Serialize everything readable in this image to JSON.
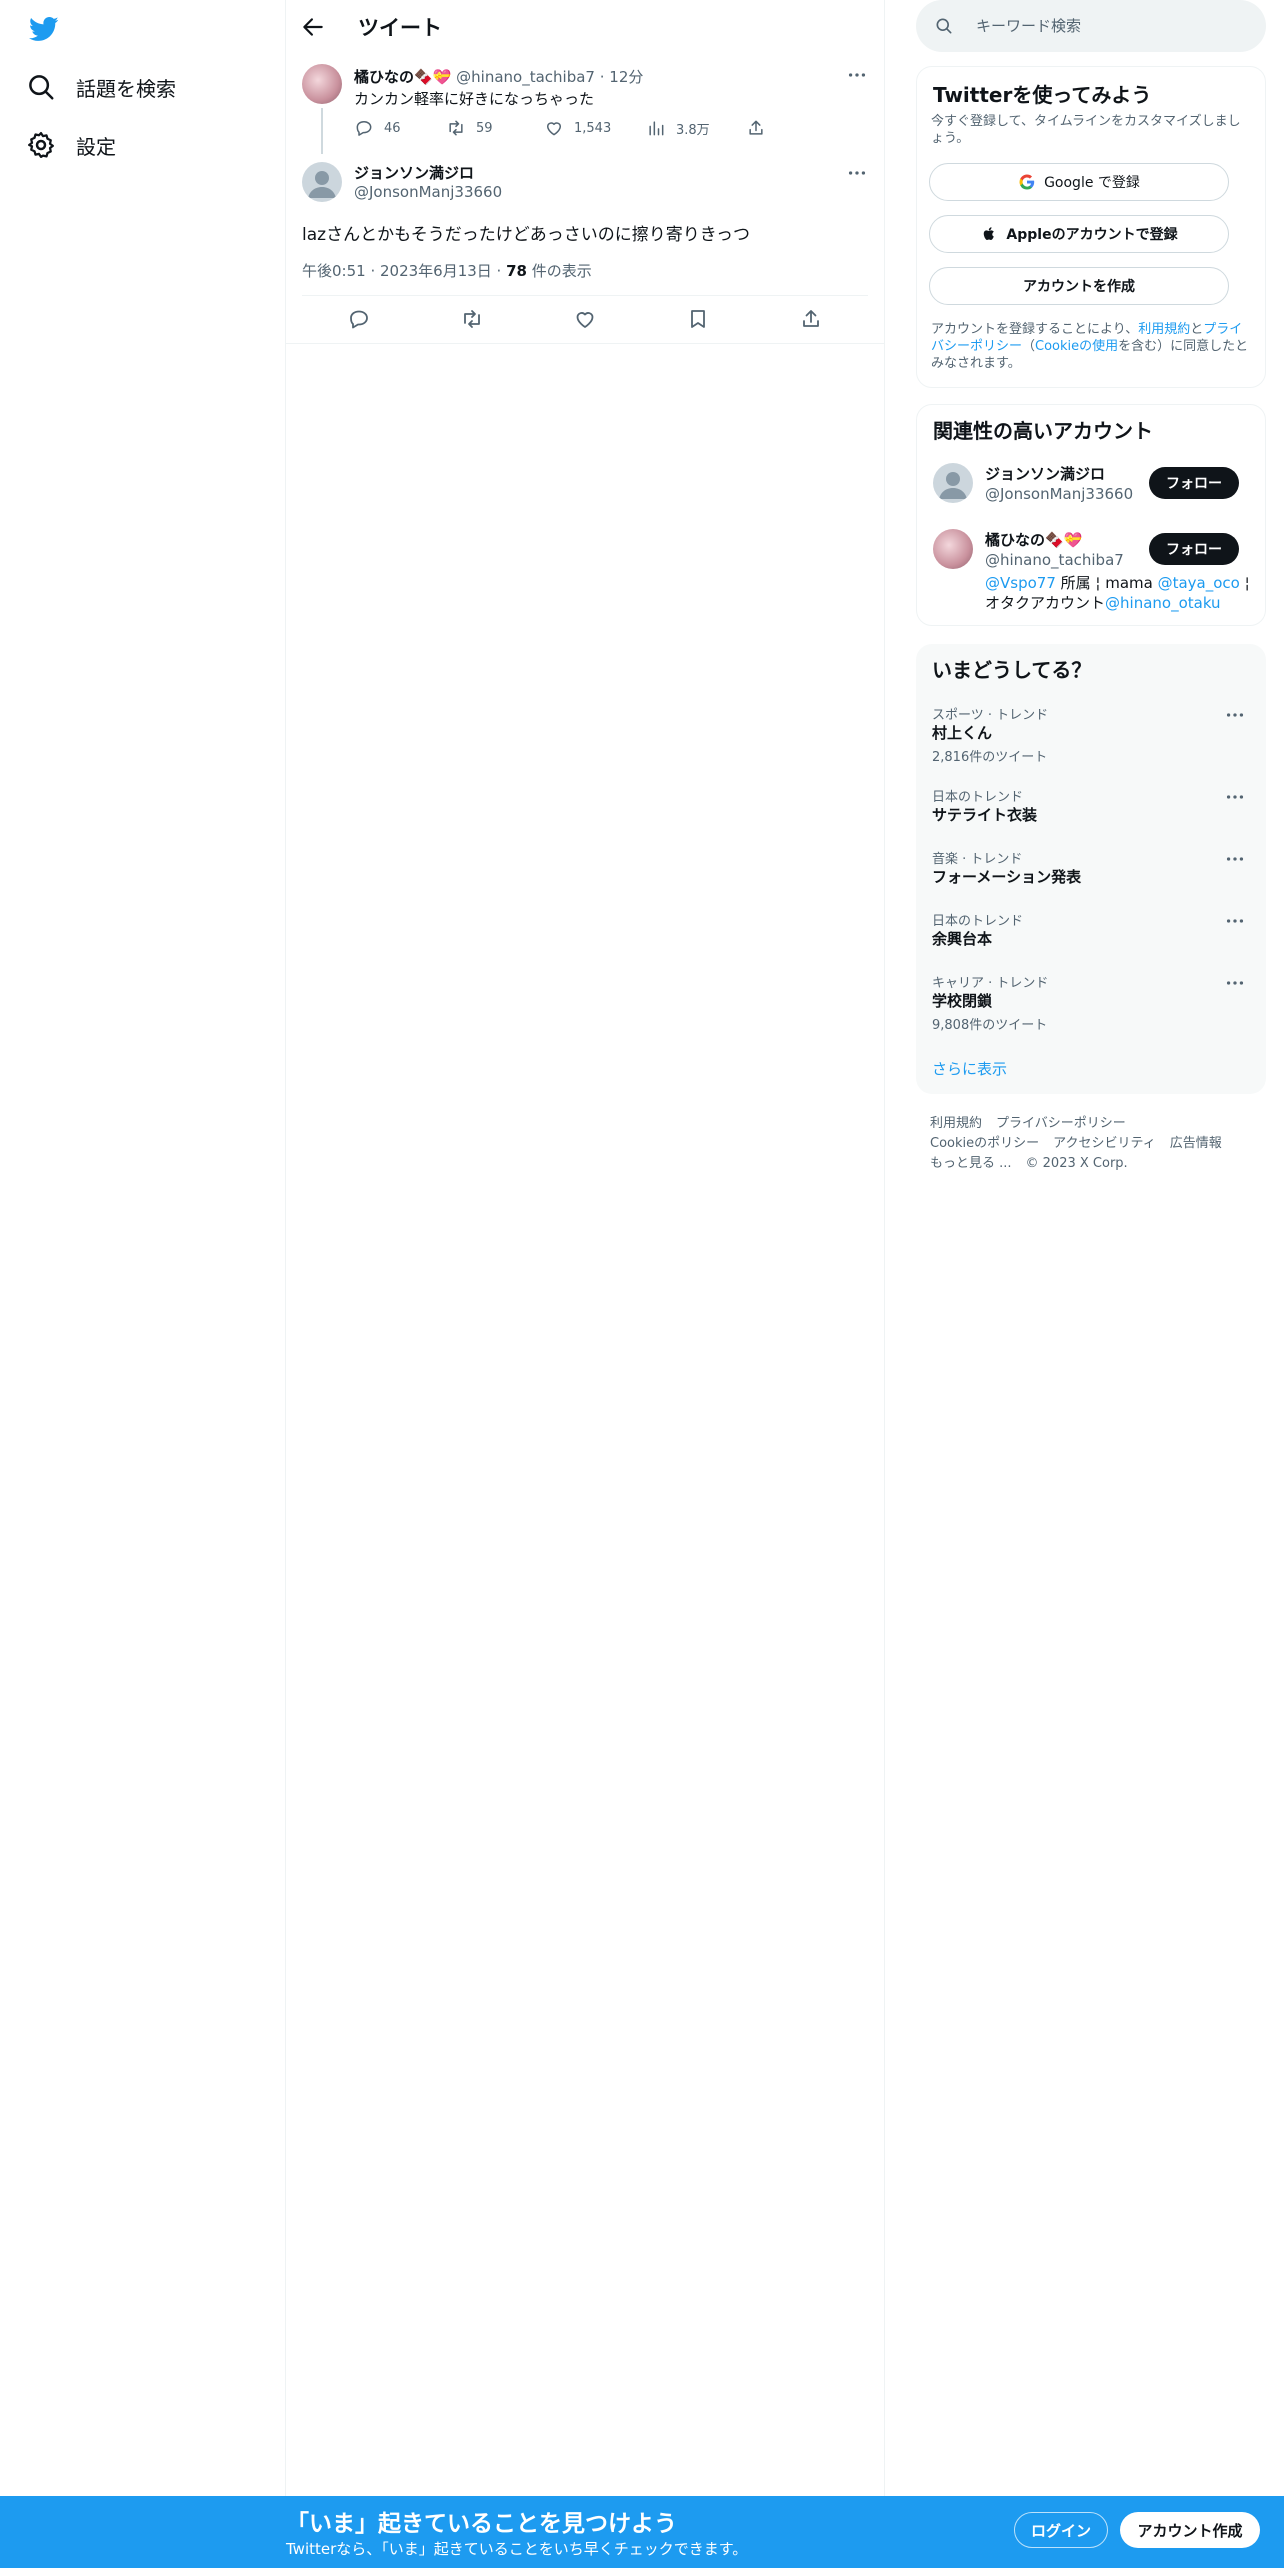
{
  "nav": {
    "logo": "twitter-bird-icon",
    "items": [
      {
        "label": "話題を検索",
        "icon": "search-icon"
      },
      {
        "label": "設定",
        "icon": "gear-icon"
      }
    ]
  },
  "main": {
    "title": "ツイート",
    "parent_tweet": {
      "name": "橘ひなの🍫💝",
      "handle": "@hinano_tachiba7",
      "dot": "·",
      "time": "12分",
      "text": "カンカン軽率に好きになっちゃった",
      "replies": "46",
      "retweets": "59",
      "likes": "1,543",
      "views": "3.8万"
    },
    "tweet": {
      "name": "ジョンソン満ジロ",
      "handle": "@JonsonManj33660",
      "text": "lazさんとかもそうだったけどあっさいのに擦り寄りきっつ",
      "datetime": "午後0:51 · 2023年6月13日 · ",
      "views": "78",
      "views_label": " 件の表示"
    }
  },
  "right": {
    "search_placeholder": "キーワード検索",
    "signup": {
      "title": "Twitterを使ってみよう",
      "subtitle": "今すぐ登録して、タイムラインをカスタマイズしましょう。",
      "google": "Google で登録",
      "apple": "Appleのアカウントで登録",
      "create": "アカウントを作成",
      "note_1": "アカウントを登録することにより、",
      "note_terms": "利用規約",
      "note_2": "と",
      "note_privacy": "プライバシーポリシー",
      "note_3": "（",
      "note_cookie": "Cookieの使用",
      "note_4": "を含む）に同意したとみなされます。"
    },
    "related": {
      "title": "関連性の高いアカウント",
      "follow_label": "フォロー",
      "accounts": [
        {
          "name": "ジョンソン満ジロ",
          "handle": "@JonsonManj33660"
        },
        {
          "name": "橘ひなの🍫💝",
          "handle": "@hinano_tachiba7",
          "bio_link1": "@Vspo77",
          "bio_1": " 所属 ¦ mama ",
          "bio_link2": "@taya_oco",
          "bio_2": " ¦ オタクアカウント",
          "bio_link3": "@hinano_otaku"
        }
      ]
    },
    "trends": {
      "title": "いまどうしてる？",
      "items": [
        {
          "category": "スポーツ · トレンド",
          "name": "村上くん",
          "count": "2,816件のツイート"
        },
        {
          "category": "日本のトレンド",
          "name": "サテライト衣装",
          "count": ""
        },
        {
          "category": "音楽 · トレンド",
          "name": "フォーメーション発表",
          "count": ""
        },
        {
          "category": "日本のトレンド",
          "name": "余興台本",
          "count": ""
        },
        {
          "category": "キャリア · トレンド",
          "name": "学校閉鎖",
          "count": "9,808件のツイート"
        }
      ],
      "show_more": "さらに表示"
    },
    "footer": {
      "terms": "利用規約",
      "privacy": "プライバシーポリシー",
      "cookie": "Cookieのポリシー",
      "accessibility": "アクセシビリティ",
      "ads": "広告情報",
      "more": "もっと見る ...",
      "copyright": "© 2023 X Corp."
    }
  },
  "bottombar": {
    "title": "「いま」起きていることを見つけよう",
    "subtitle": "Twitterなら、「いま」起きていることをいち早くチェックできます。",
    "login": "ログイン",
    "signup": "アカウント作成"
  },
  "colors": {
    "accent": "#1d9bf0",
    "text": "#0f1419",
    "secondary": "#536471"
  }
}
